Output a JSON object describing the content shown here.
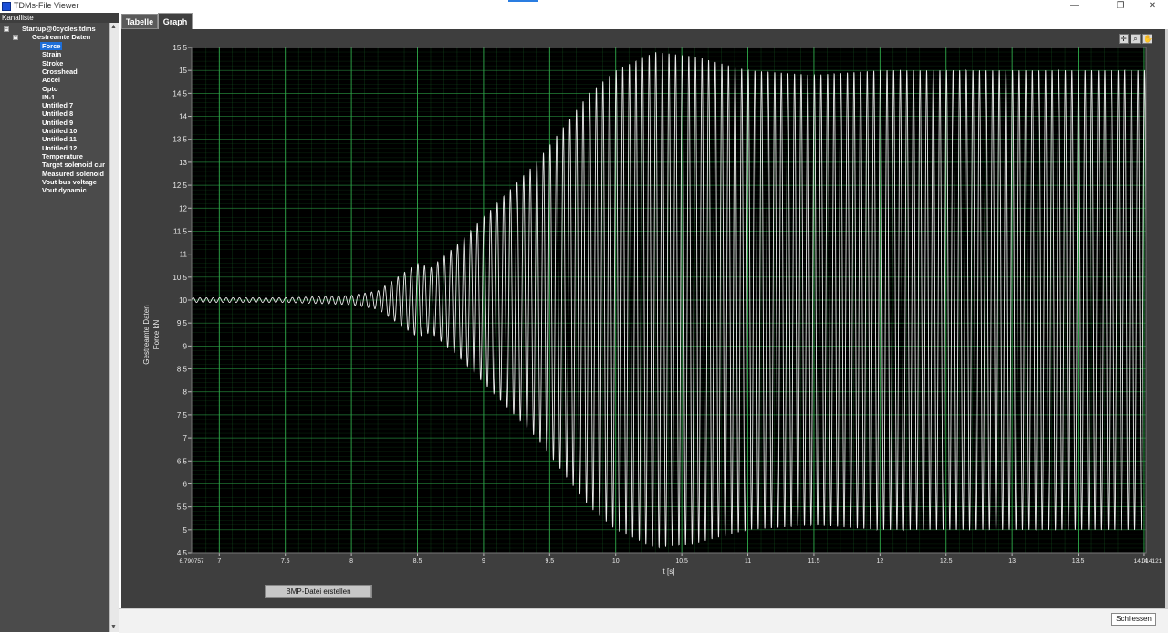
{
  "window": {
    "title": "TDMs-File Viewer",
    "minimize": "—",
    "maximize": "❐",
    "close": "✕"
  },
  "left_panel": {
    "header": "Kanalliste",
    "file": "Startup@0cycles.tdms",
    "group": "Gestreamte Daten",
    "selected": "Force",
    "channels": [
      "Force",
      "Strain",
      "Stroke",
      "Crosshead",
      "Accel",
      "Opto",
      "IN-1",
      "Untitled 7",
      "Untitled 8",
      "Untitled 9",
      "Untitled 10",
      "Untitled 11",
      "Untitled 12",
      "Temperature",
      "Target solenoid cur",
      "Measured solenoid",
      "Vout bus voltage",
      "Vout dynamic"
    ]
  },
  "tabs": [
    {
      "label": "Tabelle",
      "active": false
    },
    {
      "label": "Graph",
      "active": true
    }
  ],
  "buttons": {
    "bmp": "BMP-Datei erstellen",
    "close": "Schliessen"
  },
  "colors": {
    "plot_bg": "#000000",
    "grid": "#1f7a2e",
    "signal": "#ffffff",
    "frame": "#3e3e3e"
  },
  "chart_data": {
    "type": "line",
    "title": "",
    "xlabel": "t [s]",
    "ylabel": "Gestreamte Daten",
    "ylabel2": "Force kN",
    "xlim": [
      6.790757,
      14.014121
    ],
    "ylim": [
      4.5,
      15.5
    ],
    "x_start_label": "6.790757",
    "x_end_label": "14.014121",
    "xticks": [
      "7",
      "7.5",
      "8",
      "8.5",
      "9",
      "9.5",
      "10",
      "10.5",
      "11",
      "11.5",
      "12",
      "12.5",
      "13",
      "13.5",
      "14"
    ],
    "yticks": [
      "4.5",
      "5",
      "5.5",
      "6",
      "6.5",
      "7",
      "7.5",
      "8",
      "8.5",
      "9",
      "9.5",
      "10",
      "10.5",
      "11",
      "11.5",
      "12",
      "12.5",
      "13",
      "13.5",
      "14",
      "14.5",
      "15",
      "15.5"
    ],
    "grid": true,
    "series": [
      {
        "envelope_x": [
          6.790757,
          7.5,
          8.0,
          8.2,
          8.4,
          8.5,
          8.6,
          8.8,
          9.0,
          9.4,
          9.8,
          10.0,
          10.3,
          10.6,
          11.0,
          11.5,
          12.0,
          13.0,
          14.0,
          14.014121
        ],
        "envelope_upper": [
          10.05,
          10.05,
          10.1,
          10.2,
          10.6,
          10.8,
          10.7,
          11.2,
          11.8,
          13.0,
          14.5,
          15.0,
          15.4,
          15.3,
          15.0,
          14.9,
          15.0,
          15.0,
          15.0,
          15.0
        ],
        "envelope_lower": [
          9.95,
          9.95,
          9.9,
          9.8,
          9.4,
          9.2,
          9.3,
          8.8,
          8.2,
          7.0,
          5.5,
          5.0,
          4.6,
          4.7,
          5.0,
          5.1,
          5.0,
          5.0,
          5.0,
          5.0
        ]
      }
    ]
  }
}
